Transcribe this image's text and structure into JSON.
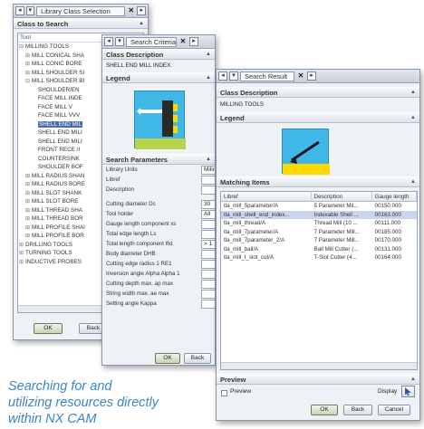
{
  "dialog1": {
    "title": "Library Class Selection",
    "section": "Class to Search",
    "column_header": "Tool",
    "tree": [
      {
        "label": "MILLING TOOLS",
        "indent": 0,
        "pm": "⊟"
      },
      {
        "label": "MILL CONICAL SHA",
        "indent": 1,
        "pm": "⊞"
      },
      {
        "label": "MILL CONIC BORE",
        "indent": 1,
        "pm": "⊞"
      },
      {
        "label": "MILL SHOULDER SI",
        "indent": 1,
        "pm": "⊞"
      },
      {
        "label": "MILL SHOULDER BI",
        "indent": 1,
        "pm": "⊟"
      },
      {
        "label": "SHOULDER/EN",
        "indent": 2,
        "pm": ""
      },
      {
        "label": "FACE MILL INDE",
        "indent": 2,
        "pm": ""
      },
      {
        "label": "FACE MILL V",
        "indent": 2,
        "pm": ""
      },
      {
        "label": "FACE MILL VVV",
        "indent": 2,
        "pm": ""
      },
      {
        "label": "SHELL END MIL",
        "indent": 2,
        "pm": "",
        "selected": true
      },
      {
        "label": "SHELL END MILI",
        "indent": 2,
        "pm": ""
      },
      {
        "label": "SHELL END MILI",
        "indent": 2,
        "pm": ""
      },
      {
        "label": "FRONT RECE /I",
        "indent": 2,
        "pm": ""
      },
      {
        "label": "COUNTERSINK",
        "indent": 2,
        "pm": ""
      },
      {
        "label": "SHOULDER BOF",
        "indent": 2,
        "pm": ""
      },
      {
        "label": "MILL RADIUS SHAN",
        "indent": 1,
        "pm": "⊞"
      },
      {
        "label": "MILL RADIUS BORE",
        "indent": 1,
        "pm": "⊞"
      },
      {
        "label": "MILL SLOT SHANK",
        "indent": 1,
        "pm": "⊞"
      },
      {
        "label": "MILL SLOT BORE",
        "indent": 1,
        "pm": "⊞"
      },
      {
        "label": "MILL THREAD SHA",
        "indent": 1,
        "pm": "⊞"
      },
      {
        "label": "MILL THREAD BOR",
        "indent": 1,
        "pm": "⊞"
      },
      {
        "label": "MILL PROFILE SHAI",
        "indent": 1,
        "pm": "⊞"
      },
      {
        "label": "MILL PROFILE BOR",
        "indent": 1,
        "pm": "⊞"
      },
      {
        "label": "DRILLING TOOLS",
        "indent": 0,
        "pm": "⊞"
      },
      {
        "label": "TURNING TOOLS",
        "indent": 0,
        "pm": "⊞"
      },
      {
        "label": "INDUCTIVE PROBES",
        "indent": 0,
        "pm": "⊞"
      }
    ],
    "ok_label": "OK",
    "back_label": "Back"
  },
  "dialog2": {
    "title": "Search Criteria",
    "class_desc_header": "Class Description",
    "class_desc_value": "SHELL END MILL INDEX.",
    "legend_header": "Legend",
    "params_header": "Search Parameters",
    "params": [
      {
        "label": "Library Units",
        "value": "Milim"
      },
      {
        "label": "Libref",
        "value": ""
      },
      {
        "label": "Description",
        "value": ""
      },
      {
        "label": "Cutting diameter Dc",
        "value": "30"
      },
      {
        "label": "Tool holder",
        "value": "All"
      },
      {
        "label": "Gauge length component xs",
        "value": ""
      },
      {
        "label": "Total edge length Ls",
        "value": ""
      },
      {
        "label": "Total length component lfxt",
        "value": "> 1"
      },
      {
        "label": "Body diameter DHB",
        "value": ""
      },
      {
        "label": "Cutting edge radius 1 RE1",
        "value": ""
      },
      {
        "label": "Inversion angle Alpha Alpha 1",
        "value": ""
      },
      {
        "label": "Cutting depth max. ap max",
        "value": ""
      },
      {
        "label": "String width max. ae max",
        "value": ""
      },
      {
        "label": "Setting angle Kappa",
        "value": ""
      }
    ],
    "ok_label": "OK",
    "back_label": "Back"
  },
  "dialog3": {
    "title": "Search Result",
    "class_desc_header": "Class Description",
    "class_desc_value": "MILLING TOOLS",
    "legend_header": "Legend",
    "matching_header": "Matching Items",
    "columns": [
      "Libref",
      "Description",
      "Gauge length"
    ],
    "rows": [
      {
        "libref": "tla_mill_5parameter/A",
        "desc": "5 Parameter Mil...",
        "gauge": "00150.000"
      },
      {
        "libref": "tla_mill_shell_end_index...",
        "desc": "Indexable Shell ...",
        "gauge": "00163.000",
        "selected": true
      },
      {
        "libref": "tla_mill_thread/A",
        "desc": "Thread Mill (10 ...",
        "gauge": "00111.000"
      },
      {
        "libref": "tla_mill_7parameter/A",
        "desc": "7 Parameter Mill...",
        "gauge": "00185.000"
      },
      {
        "libref": "tla_mill_7parameter_2/A",
        "desc": "7 Parameter Mill...",
        "gauge": "00170.000"
      },
      {
        "libref": "tla_mill_ball/A",
        "desc": "Ball Mill Cutter (...",
        "gauge": "00131.000"
      },
      {
        "libref": "tla_mill_t_slot_cut/A",
        "desc": "T-Slot Cutter (4...",
        "gauge": "00164.000"
      }
    ],
    "preview_header": "Preview",
    "preview_label": "Preview",
    "display_label": "Display",
    "ok_label": "OK",
    "back_label": "Back",
    "cancel_label": "Cancel"
  },
  "caption": {
    "line1": "Searching for and",
    "line2": "utilizing resources directly",
    "line3": "within NX CAM"
  },
  "colors": {
    "caption": "#3a86c6",
    "selection": "#4a6ea8",
    "row_selection": "#c7d6ee",
    "legend_bg": "#3fb8e8"
  }
}
